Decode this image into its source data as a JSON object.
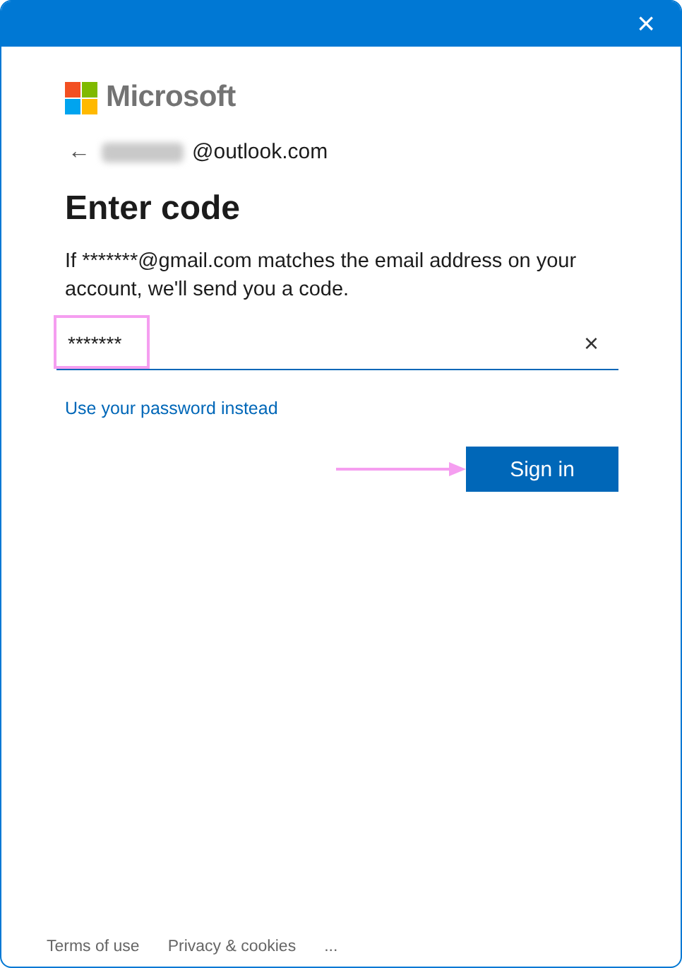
{
  "window": {
    "close": "×"
  },
  "brand": "Microsoft",
  "account": {
    "back": "←",
    "email_suffix": "@outlook.com"
  },
  "heading": "Enter code",
  "message": "If *******@gmail.com matches the email address on your account, we'll send you a code.",
  "code_field": {
    "value": "*******",
    "clear": "×",
    "highlighted": true
  },
  "alt_link": "Use your password instead",
  "sign_in_button": {
    "label": "Sign in",
    "pointed": true
  },
  "footer": [
    "Terms of use",
    "Privacy & cookies",
    "..."
  ]
}
